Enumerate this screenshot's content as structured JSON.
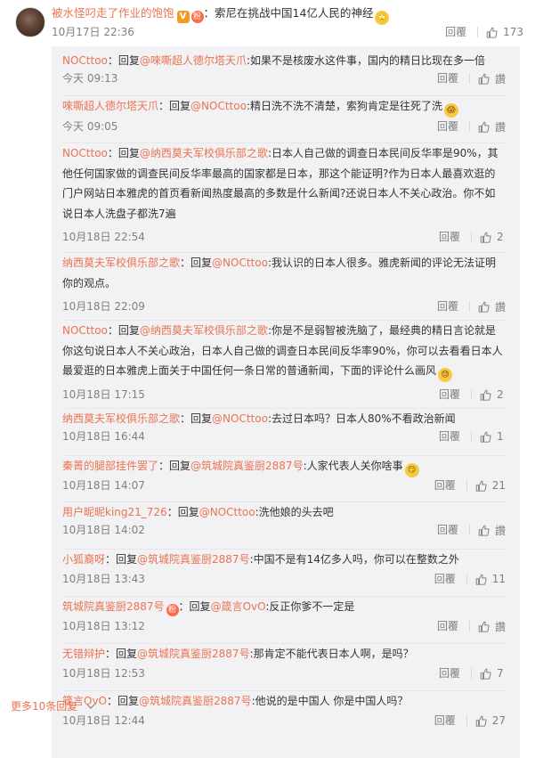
{
  "main_comment": {
    "username": "被水怪叼走了作业的饱饱",
    "badge_v": "V",
    "fan_badge": "粉",
    "separator": "：",
    "text": "索尼在挑战中国14亿人民的神经",
    "emoji": "🙄",
    "time": "10月17日 22:36",
    "reply_label": "回覆",
    "likes": "173"
  },
  "replies": [
    {
      "user": "NOCttoo",
      "text": "：回复",
      "mention": "@唻嘶超人德尔塔天爪",
      "content": ":如果不是核废水这件事，国内的精日比现在多一倍",
      "time": "今天 09:13",
      "reply_label": "回覆",
      "likes": "讚"
    },
    {
      "user": "唻嘶超人德尔塔天爪",
      "text": "：回复",
      "mention": "@NOCttoo",
      "content": ":精日洗不洗不清楚，索狗肯定是往死了洗",
      "emoji": "😱",
      "time": "今天 09:05",
      "reply_label": "回覆",
      "likes": "讚"
    },
    {
      "user": "NOCttoo",
      "text": "：回复",
      "mention": "@纳西莫夫军校俱乐部之歌",
      "content": ":日本人自己做的调查日本民间反华率是90%，其他任何国家做的调查民间反华率最高的国家都是日本，那这个能证明?作为日本人最喜欢逛的门户网站日本雅虎的首页看新闻热度最高的多数是什么新闻?还说日本人不关心政治。你不如说日本人洗盘子都洗7遍",
      "time": "10月18日 22:54",
      "reply_label": "回覆",
      "likes": "2"
    },
    {
      "user": "纳西莫夫军校俱乐部之歌",
      "text": "：回复",
      "mention": "@NOCttoo",
      "content": ":我认识的日本人很多。雅虎新闻的评论无法证明你的观点。",
      "time": "10月18日 22:09",
      "reply_label": "回覆",
      "likes": "讚"
    },
    {
      "user": "NOCttoo",
      "text": "：回复",
      "mention": "@纳西莫夫军校俱乐部之歌",
      "content": ":你是不是弱智被洗脑了，最经典的精日言论就是你这句说日本人不关心政治，日本人自己做的调查日本民间反华率90%，你可以去看看日本人最爱逛的日本雅虎上面关于中国任何一条日常的普通新闻，下面的评论什么画风",
      "emoji": "😓",
      "time": "10月18日 17:15",
      "reply_label": "回覆",
      "likes": "2"
    },
    {
      "user": "纳西莫夫军校俱乐部之歌",
      "text": "：回复",
      "mention": "@NOCttoo",
      "content": ":去过日本吗？日本人80%不看政治新闻",
      "time": "10月18日 16:44",
      "reply_label": "回覆",
      "likes": "1"
    },
    {
      "user": "秦菁的腿部挂件罢了",
      "text": "：回复",
      "mention": "@筑城院真鉴厨2887号",
      "content": ":人家代表人关你啥事",
      "emoji": "😏",
      "time": "10月18日 14:07",
      "reply_label": "回覆",
      "likes": "21"
    },
    {
      "user": "用户昵昵king21_726",
      "text": "：回复",
      "mention": "@NOCttoo",
      "content": ":洗他娘的头去吧",
      "time": "10月18日 14:02",
      "reply_label": "回覆",
      "likes": "讚"
    },
    {
      "user": "小狐裔呀",
      "text": "：回复",
      "mention": "@筑城院真鉴厨2887号",
      "content": ":中国不是有14亿多人吗，你可以在整数之外",
      "time": "10月18日 13:43",
      "reply_label": "回覆",
      "likes": "11"
    },
    {
      "user": "筑城院真鉴厨2887号",
      "fan_badge": "粉",
      "text": "：回复",
      "mention": "@箴言OvO",
      "content": ":反正你爹不一定是",
      "time": "10月18日 13:12",
      "reply_label": "回覆",
      "likes": "讚"
    },
    {
      "user": "无错辩护",
      "text": "：回复",
      "mention": "@筑城院真鉴厨2887号",
      "content": ":那肯定不能代表日本人啊，是吗？",
      "time": "10月18日 12:53",
      "reply_label": "回覆",
      "likes": "7"
    },
    {
      "user": "箴言OvO",
      "text": "：回复",
      "mention": "@筑城院真鉴厨2887号",
      "content": ":他说的是中国人 你是中国人吗？",
      "time": "10月18日 12:44",
      "reply_label": "回覆",
      "likes": "27"
    }
  ],
  "more_replies": "更多10条回复",
  "more_icon": "chevron-down-icon"
}
